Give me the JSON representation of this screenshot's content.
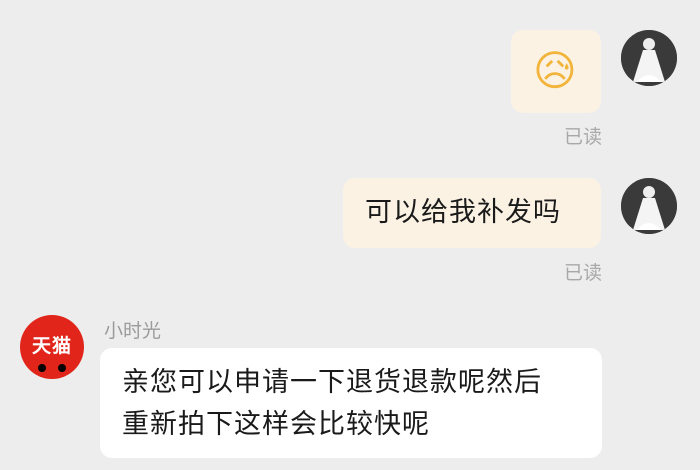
{
  "messages": [
    {
      "emoji": "😥",
      "read_label": "已读"
    },
    {
      "text": "可以给我补发吗",
      "read_label": "已读"
    }
  ],
  "incoming": {
    "brand_label": "天猫",
    "sender_name": "小时光",
    "text_line1": "亲您可以申请一下退货退款呢然后",
    "text_line2": "重新拍下这样会比较快呢"
  },
  "colors": {
    "background": "#ededed",
    "outgoing_bubble": "#fbf2e3",
    "incoming_bubble": "#ffffff",
    "brand_red": "#e1251b",
    "read_text": "#a8a8a8"
  }
}
